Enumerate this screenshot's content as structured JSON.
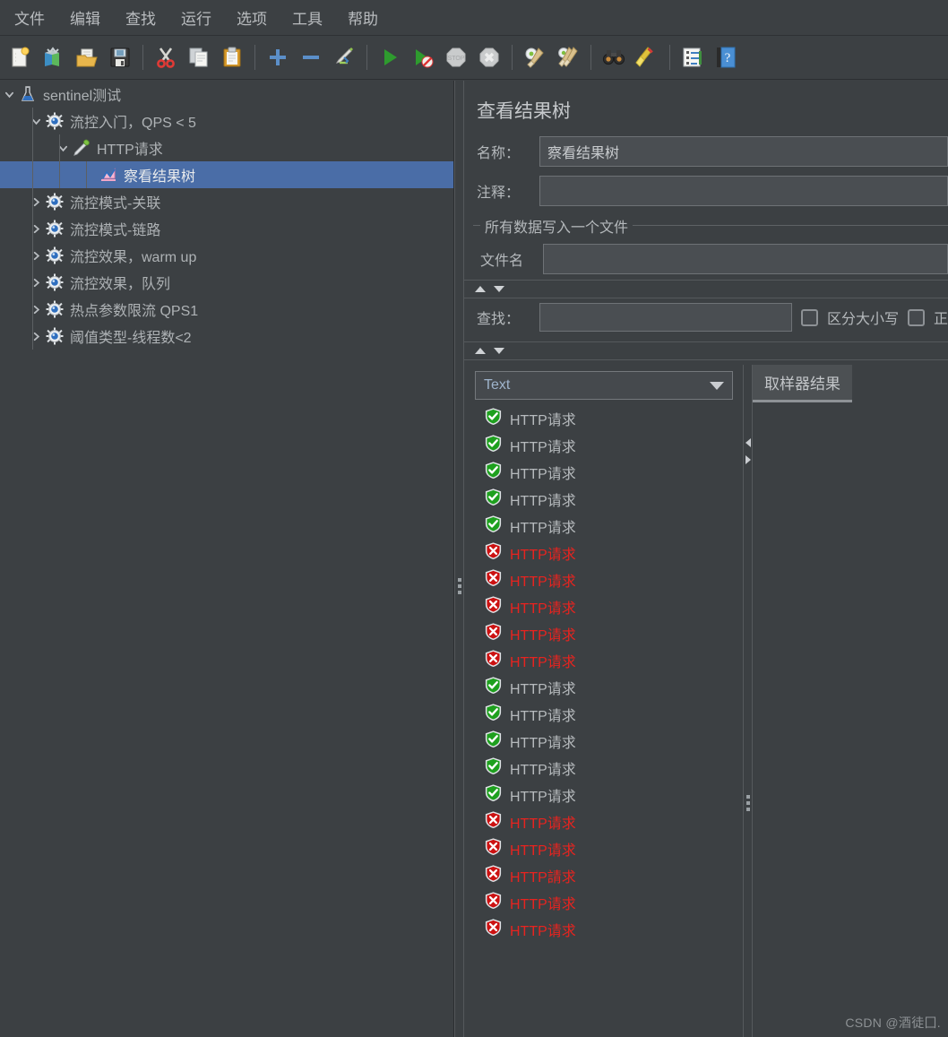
{
  "menubar": {
    "items": [
      {
        "label": "文件",
        "name": "menu-file"
      },
      {
        "label": "编辑",
        "name": "menu-edit"
      },
      {
        "label": "查找",
        "name": "menu-search"
      },
      {
        "label": "运行",
        "name": "menu-run"
      },
      {
        "label": "选项",
        "name": "menu-options"
      },
      {
        "label": "工具",
        "name": "menu-tools"
      },
      {
        "label": "帮助",
        "name": "menu-help"
      }
    ]
  },
  "toolbar": {
    "buttons": [
      {
        "icon": "new-document-icon",
        "group": 1
      },
      {
        "icon": "new-test-plan-icon",
        "group": 1
      },
      {
        "icon": "open-folder-icon",
        "group": 1
      },
      {
        "icon": "save-floppy-icon",
        "group": 1
      },
      {
        "icon": "cut-scissors-icon",
        "group": 2
      },
      {
        "icon": "copy-pages-icon",
        "group": 2
      },
      {
        "icon": "paste-clipboard-icon",
        "group": 2
      },
      {
        "icon": "expand-plus-icon",
        "group": 3
      },
      {
        "icon": "collapse-minus-icon",
        "group": 3
      },
      {
        "icon": "toggle-pencil-icon",
        "group": 3
      },
      {
        "icon": "start-play-icon",
        "group": 4
      },
      {
        "icon": "start-no-timers-icon",
        "group": 4
      },
      {
        "icon": "stop-icon",
        "group": 4
      },
      {
        "icon": "shutdown-icon",
        "group": 4
      },
      {
        "icon": "clear-gear-broom-icon",
        "group": 5
      },
      {
        "icon": "clear-all-gear-broom-icon",
        "group": 5
      },
      {
        "icon": "search-binoculars-icon",
        "group": 6
      },
      {
        "icon": "reset-search-broom-icon",
        "group": 6
      },
      {
        "icon": "function-helper-icon",
        "group": 7
      },
      {
        "icon": "help-question-icon",
        "group": 7
      }
    ]
  },
  "tree": {
    "nodes": [
      {
        "label": "sentinel测试",
        "icon": "flask-icon",
        "depth": 0,
        "toggle": "expanded",
        "selected": false
      },
      {
        "label": "流控入门，QPS < 5",
        "icon": "gear-icon",
        "depth": 1,
        "toggle": "expanded",
        "selected": false
      },
      {
        "label": "HTTP请求",
        "icon": "pipette-icon",
        "depth": 2,
        "toggle": "expanded",
        "selected": false
      },
      {
        "label": "察看结果树",
        "icon": "result-tree-icon",
        "depth": 3,
        "toggle": "none",
        "selected": true
      },
      {
        "label": "流控模式-关联",
        "icon": "gear-icon",
        "depth": 1,
        "toggle": "collapsed",
        "selected": false
      },
      {
        "label": "流控模式-链路",
        "icon": "gear-icon",
        "depth": 1,
        "toggle": "collapsed",
        "selected": false
      },
      {
        "label": "流控效果，warm up",
        "icon": "gear-icon",
        "depth": 1,
        "toggle": "collapsed",
        "selected": false
      },
      {
        "label": "流控效果，队列",
        "icon": "gear-icon",
        "depth": 1,
        "toggle": "collapsed",
        "selected": false
      },
      {
        "label": "热点参数限流 QPS1",
        "icon": "gear-icon",
        "depth": 1,
        "toggle": "collapsed",
        "selected": false
      },
      {
        "label": "阈值类型-线程数<2",
        "icon": "gear-icon",
        "depth": 1,
        "toggle": "collapsed",
        "selected": false
      }
    ]
  },
  "panel": {
    "title": "查看结果树",
    "name_label": "名称：",
    "name_value": "察看结果树",
    "comment_label": "注释：",
    "comment_value": "",
    "group_legend": "所有数据写入一个文件",
    "filename_label": "文件名",
    "filename_value": "",
    "search_label": "查找：",
    "search_value": "",
    "case_sensitive_label": "区分大小写",
    "regex_label": "正",
    "render_selected": "Text",
    "tab_sampler_result": "取样器结果"
  },
  "samplers": [
    {
      "label": "HTTP请求",
      "status": "ok"
    },
    {
      "label": "HTTP请求",
      "status": "ok"
    },
    {
      "label": "HTTP请求",
      "status": "ok"
    },
    {
      "label": "HTTP请求",
      "status": "ok"
    },
    {
      "label": "HTTP请求",
      "status": "ok"
    },
    {
      "label": "HTTP请求",
      "status": "fail"
    },
    {
      "label": "HTTP请求",
      "status": "fail"
    },
    {
      "label": "HTTP请求",
      "status": "fail"
    },
    {
      "label": "HTTP请求",
      "status": "fail"
    },
    {
      "label": "HTTP请求",
      "status": "fail"
    },
    {
      "label": "HTTP请求",
      "status": "ok"
    },
    {
      "label": "HTTP请求",
      "status": "ok"
    },
    {
      "label": "HTTP请求",
      "status": "ok"
    },
    {
      "label": "HTTP请求",
      "status": "ok"
    },
    {
      "label": "HTTP请求",
      "status": "ok"
    },
    {
      "label": "HTTP请求",
      "status": "fail"
    },
    {
      "label": "HTTP请求",
      "status": "fail"
    },
    {
      "label": "HTTP請求",
      "status": "fail"
    },
    {
      "label": "HTTP请求",
      "status": "fail"
    },
    {
      "label": "HTTP请求",
      "status": "fail"
    }
  ],
  "watermark": "CSDN @酒徒囗.",
  "colors": {
    "background": "#3c4043",
    "selection": "#4a6da7",
    "success": "#1fa41f",
    "failure": "#e8231f",
    "text": "#b4b8bb"
  }
}
